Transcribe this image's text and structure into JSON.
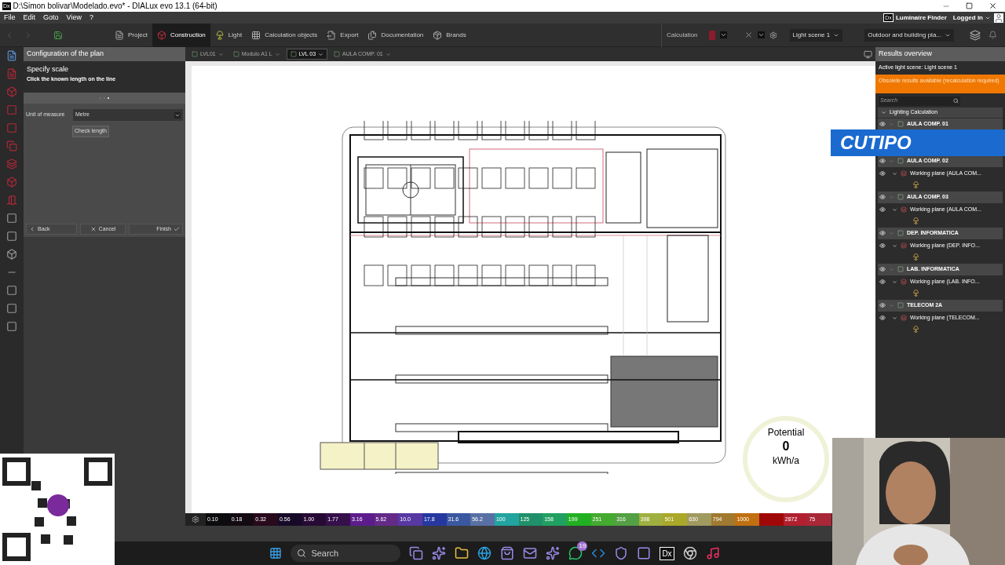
{
  "title_bar": {
    "logo": "Dx",
    "title": "D:\\Simon bolivar\\Modelado.evo* - DIALux evo 13.1  (64-bit)"
  },
  "menu_bar": {
    "items": [
      "File",
      "Edit",
      "Goto",
      "View",
      "?"
    ],
    "finder_logo": "Dx",
    "finder": "Luminaire Finder",
    "account": "Logged in"
  },
  "toolbar": {
    "tabs": [
      {
        "label": "Project",
        "selected": false
      },
      {
        "label": "Construction",
        "selected": true
      },
      {
        "label": "Light",
        "selected": false
      },
      {
        "label": "Calculation objects",
        "selected": false
      },
      {
        "label": "Export",
        "selected": false
      },
      {
        "label": "Documentation",
        "selected": false
      },
      {
        "label": "Brands",
        "selected": false
      }
    ],
    "calculation": "Calculation",
    "light_scene": "Light scene 1",
    "view_filter": "Outdoor and building pla..."
  },
  "left_panel": {
    "title": "Configuration of the plan",
    "step_title": "Specify scale",
    "step_hint": "Click the known length on the line",
    "step_dots": [
      {
        "selected": false
      },
      {
        "selected": false
      },
      {
        "selected": true
      }
    ],
    "unit_label": "Unit of measure",
    "unit_value": "Metre",
    "check_button": "Check length",
    "back": "Back",
    "cancel": "Cancel",
    "finish": "Finish"
  },
  "canvas_tabs": [
    {
      "label": "LVL01",
      "selected": false
    },
    {
      "label": "Modulo A1 L",
      "selected": false
    },
    {
      "label": "LVL 03",
      "selected": true
    },
    {
      "label": "AULA COMP. 01",
      "selected": false
    }
  ],
  "potential": {
    "label": "Potential",
    "value": "0",
    "unit": "kWh/a"
  },
  "color_scale": [
    {
      "label": "0.10",
      "color": "#0c0c0e"
    },
    {
      "label": "0.18",
      "color": "#140a12"
    },
    {
      "label": "0.32",
      "color": "#280a1c"
    },
    {
      "label": "0.56",
      "color": "#160a28"
    },
    {
      "label": "1.00",
      "color": "#260a34"
    },
    {
      "label": "1.77",
      "color": "#36104a"
    },
    {
      "label": "3.16",
      "color": "#5c1c8c"
    },
    {
      "label": "5.62",
      "color": "#642a88"
    },
    {
      "label": "10.0",
      "color": "#5838a2"
    },
    {
      "label": "17.8",
      "color": "#2638a0"
    },
    {
      "label": "31.6",
      "color": "#3a58a0"
    },
    {
      "label": "56.2",
      "color": "#5870a4"
    },
    {
      "label": "100",
      "color": "#22a4a0"
    },
    {
      "label": "125",
      "color": "#20906a"
    },
    {
      "label": "158",
      "color": "#22a062"
    },
    {
      "label": "199",
      "color": "#22b022"
    },
    {
      "label": "251",
      "color": "#44aa30"
    },
    {
      "label": "316",
      "color": "#54a044"
    },
    {
      "label": "398",
      "color": "#a0b040"
    },
    {
      "label": "501",
      "color": "#aaa828"
    },
    {
      "label": "630",
      "color": "#a09a60"
    },
    {
      "label": "794",
      "color": "#a07a30"
    },
    {
      "label": "1000",
      "color": "#c07010"
    },
    {
      "color": "#a00808"
    },
    {
      "label": "2872",
      "color": "#b02030"
    },
    {
      "label": "75",
      "color": "#a82838"
    }
  ],
  "results": {
    "title": "Results overview",
    "active_scene": "Active light scene: Light scene 1",
    "warning": "Obsolete results available (recalculation required)",
    "search_placeholder": "Search",
    "root": {
      "label": "Lighting Calculation",
      "expanded": true
    },
    "rooms": [
      {
        "label": "AULA COMP. 01",
        "visible": true,
        "expanded": true
      },
      {
        "label": "AULA COMP. 02",
        "visible": true,
        "expanded": true,
        "children": [
          {
            "label": "Working plane (AULA COM...",
            "visible": true,
            "expanded": true
          }
        ]
      },
      {
        "label": "AULA COMP. 03",
        "visible": true,
        "expanded": true,
        "children": [
          {
            "label": "Working plane (AULA COM...",
            "visible": true,
            "expanded": true
          }
        ]
      },
      {
        "label": "DEP. INFORMATICA",
        "visible": true,
        "expanded": true,
        "children": [
          {
            "label": "Working plane (DEP. INFO...",
            "visible": true,
            "expanded": true
          }
        ]
      },
      {
        "label": "LAB. INFORMATICA",
        "visible": true,
        "expanded": true,
        "children": [
          {
            "label": "Working plane (LAB. INFO...",
            "visible": true,
            "expanded": true
          }
        ]
      },
      {
        "label": "TELECOM 2A",
        "visible": true,
        "expanded": true,
        "children": [
          {
            "label": "Working plane (TELECOM...",
            "visible": true,
            "expanded": true
          }
        ]
      }
    ]
  },
  "overlay_banner": "CUTIPO",
  "taskbar": {
    "search_placeholder": "Search",
    "badge": "19",
    "active_app_logo": "Dx"
  }
}
